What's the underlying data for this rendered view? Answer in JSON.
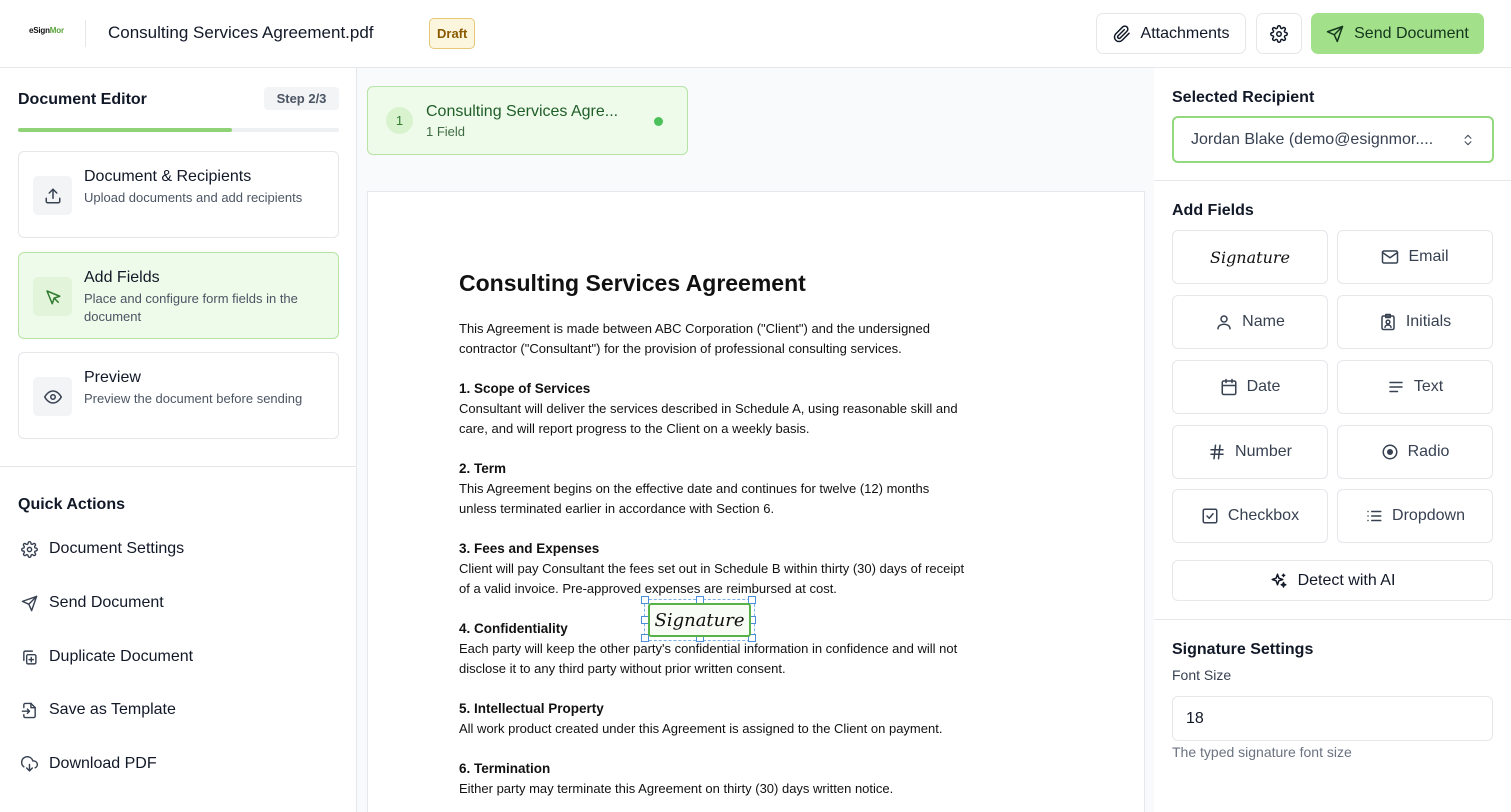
{
  "app": {
    "logo_main": "eSign",
    "logo_accent": "Mor",
    "document_title": "Consulting Services Agreement.pdf",
    "status_badge": "Draft",
    "attachments_label": "Attachments",
    "send_label": "Send Document"
  },
  "sidebar": {
    "title": "Document Editor",
    "step_badge": "Step 2/3",
    "progress_fraction": 0.667,
    "steps": [
      {
        "title": "Document & Recipients",
        "description": "Upload documents and add recipients",
        "icon": "upload-icon",
        "active": false
      },
      {
        "title": "Add Fields",
        "description": "Place and configure form fields in the document",
        "icon": "cursor-icon",
        "active": true
      },
      {
        "title": "Preview",
        "description": "Preview the document before sending",
        "icon": "eye-icon",
        "active": false
      }
    ],
    "quick_actions_title": "Quick Actions",
    "quick_actions": [
      {
        "label": "Document Settings",
        "icon": "gear-icon"
      },
      {
        "label": "Send Document",
        "icon": "send-icon"
      },
      {
        "label": "Duplicate Document",
        "icon": "duplicate-icon"
      },
      {
        "label": "Save as Template",
        "icon": "template-icon"
      },
      {
        "label": "Download PDF",
        "icon": "download-icon"
      }
    ]
  },
  "document_tab": {
    "number": "1",
    "name": "Consulting Services Agre...",
    "field_count": "1 Field"
  },
  "document": {
    "heading": "Consulting Services Agreement",
    "intro": "This Agreement is made between ABC Corporation (\"Client\") and the undersigned contractor (\"Consultant\") for the provision of professional consulting services.",
    "sections": [
      {
        "title": "1. Scope of Services",
        "body": "Consultant will deliver the services described in Schedule A, using reasonable skill and care, and will report progress to the Client on a weekly basis."
      },
      {
        "title": "2. Term",
        "body": "This Agreement begins on the effective date and continues for twelve (12) months unless terminated earlier in accordance with Section 6."
      },
      {
        "title": "3. Fees and Expenses",
        "body": "Client will pay Consultant the fees set out in Schedule B within thirty (30) days of receipt of a valid invoice. Pre-approved expenses are reimbursed at cost."
      },
      {
        "title": "4. Confidentiality",
        "body": "Each party will keep the other party's confidential information in confidence and will not disclose it to any third party without prior written consent."
      },
      {
        "title": "5. Intellectual Property",
        "body": "All work product created under this Agreement is assigned to the Client on payment."
      },
      {
        "title": "6. Termination",
        "body": "Either party may terminate this Agreement on thirty (30) days written notice."
      }
    ],
    "placed_field_label": "Signature"
  },
  "right_panel": {
    "recipient_title": "Selected Recipient",
    "recipient_value": "Jordan Blake (demo@esignmor....",
    "add_fields_title": "Add Fields",
    "fields": [
      {
        "label": "Signature",
        "icon": "signature"
      },
      {
        "label": "Email",
        "icon": "mail-icon"
      },
      {
        "label": "Name",
        "icon": "user-icon"
      },
      {
        "label": "Initials",
        "icon": "id-badge-icon"
      },
      {
        "label": "Date",
        "icon": "calendar-icon"
      },
      {
        "label": "Text",
        "icon": "text-lines-icon"
      },
      {
        "label": "Number",
        "icon": "hash-icon"
      },
      {
        "label": "Radio",
        "icon": "radio-icon"
      },
      {
        "label": "Checkbox",
        "icon": "checkbox-icon"
      },
      {
        "label": "Dropdown",
        "icon": "list-icon"
      }
    ],
    "detect_label": "Detect with AI",
    "settings_title": "Signature Settings",
    "font_size_label": "Font Size",
    "font_size_value": "18",
    "font_size_help": "The typed signature font size"
  },
  "colors": {
    "accent": "#a3e08a",
    "accent_border": "#93d97d",
    "active_bg": "#effbea",
    "draft_bg": "#fdf6df"
  }
}
